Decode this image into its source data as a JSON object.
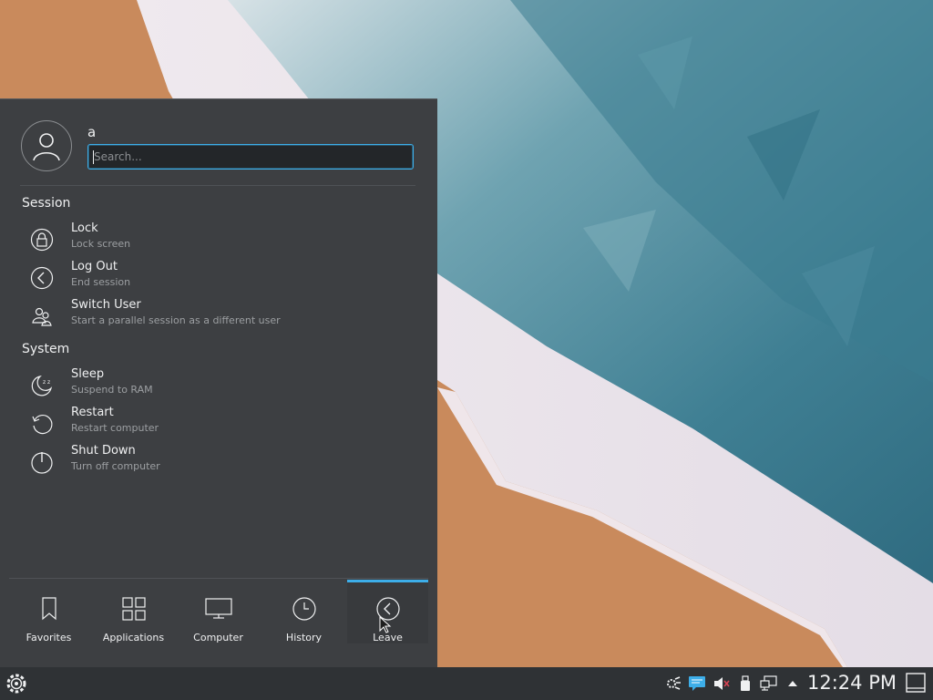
{
  "user": {
    "name": "a",
    "avatar_icon": "user-icon"
  },
  "search": {
    "placeholder": "Search...",
    "value": ""
  },
  "sections": {
    "session": {
      "title": "Session",
      "items": [
        {
          "label": "Lock",
          "sub": "Lock screen",
          "icon": "lock-icon"
        },
        {
          "label": "Log Out",
          "sub": "End session",
          "icon": "logout-icon"
        },
        {
          "label": "Switch User",
          "sub": "Start a parallel session as a different user",
          "icon": "switch-user-icon"
        }
      ]
    },
    "system": {
      "title": "System",
      "items": [
        {
          "label": "Sleep",
          "sub": "Suspend to RAM",
          "icon": "sleep-icon"
        },
        {
          "label": "Restart",
          "sub": "Restart computer",
          "icon": "restart-icon"
        },
        {
          "label": "Shut Down",
          "sub": "Turn off computer",
          "icon": "power-icon"
        }
      ]
    }
  },
  "tabs": [
    {
      "label": "Favorites",
      "icon": "bookmark-icon"
    },
    {
      "label": "Applications",
      "icon": "grid-icon"
    },
    {
      "label": "Computer",
      "icon": "monitor-icon"
    },
    {
      "label": "History",
      "icon": "clock-icon"
    },
    {
      "label": "Leave",
      "icon": "leave-icon",
      "active": true
    }
  ],
  "taskbar": {
    "launcher_icon": "kde-gear-icon",
    "tray_icons": [
      "network-tools-icon",
      "notifications-icon",
      "volume-muted-icon",
      "usb-drive-icon",
      "network-wired-icon",
      "expand-tray-icon"
    ],
    "clock": "12:24 PM",
    "show_desktop_icon": "show-desktop-icon"
  },
  "colors": {
    "accent": "#3daee9",
    "panel": "#3d3f42",
    "taskbar": "#2f3235",
    "text": "#eff0f1"
  }
}
